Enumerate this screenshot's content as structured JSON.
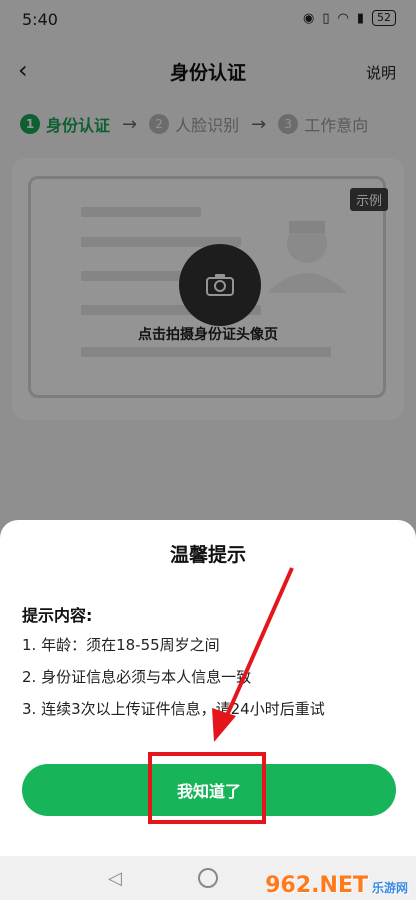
{
  "status": {
    "time": "5:40",
    "battery": "52"
  },
  "header": {
    "title": "身份认证",
    "help": "说明",
    "back": "‹"
  },
  "steps": [
    {
      "num": "1",
      "label": "身份认证"
    },
    {
      "num": "2",
      "label": "人脸识别"
    },
    {
      "num": "3",
      "label": "工作意向"
    }
  ],
  "card": {
    "sample": "示例",
    "hint": "点击拍摄身份证头像页"
  },
  "sheet": {
    "title": "温馨提示",
    "content_title": "提示内容:",
    "items": [
      "1. 年龄：须在18-55周岁之间",
      "2. 身份证信息必须与本人信息一致",
      "3. 连续3次以上传证件信息，请24小时后重试"
    ],
    "button": "我知道了"
  },
  "watermark": {
    "main": "962.NET",
    "sub": "乐游网"
  },
  "colors": {
    "accent": "#18b45a",
    "annotation": "#e4161b"
  }
}
